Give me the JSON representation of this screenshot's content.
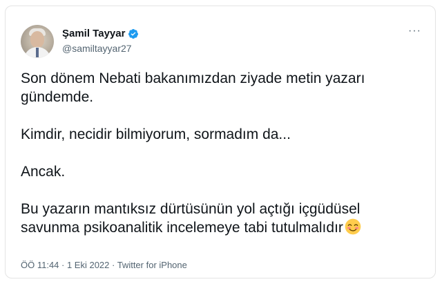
{
  "author": {
    "display_name": "Şamil Tayyar",
    "handle": "@samiltayyar27",
    "verified": true,
    "verified_color": "#1d9bf0"
  },
  "tweet": {
    "paragraphs": [
      "Son dönem Nebati bakanımızdan ziyade metin yazarı gündemde.",
      "Kimdir, necidir bilmiyorum, sormadım da...",
      "Ancak.",
      "Bu yazarın mantıksız dürtüsünün yol açtığı içgüdüsel savunma psikoanalitik incelemeye tabi tutulmalıdır"
    ],
    "emoji": "smiling-face-with-smiling-eyes"
  },
  "meta": {
    "text": "ÖÖ 11:44 · 1 Eki 2022 · Twitter for iPhone"
  },
  "icons": {
    "more": "more-options-icon",
    "verified": "verified-badge-icon"
  },
  "more_glyph": "···"
}
